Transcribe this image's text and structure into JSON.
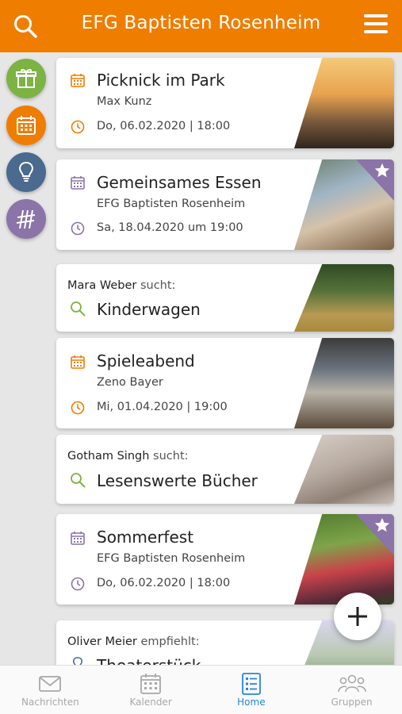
{
  "header": {
    "title": "EFG Baptisten Rosenheim",
    "search_icon": "search-icon",
    "menu_icon": "menu-icon"
  },
  "colors": {
    "brand": "#ef7d00",
    "green": "#7cb342",
    "purple": "#8a74a8",
    "slate": "#4b6a8f",
    "active_tab": "#2a86d6"
  },
  "side_nav": [
    {
      "icon": "gift-icon"
    },
    {
      "icon": "calendar-icon"
    },
    {
      "icon": "lightbulb-icon"
    },
    {
      "icon": "tags-icon"
    }
  ],
  "feed": [
    {
      "kind": "event",
      "title": "Picknick im Park",
      "organizer": "Max Kunz",
      "datetime": "Do, 06.02.2020 | 18:00",
      "accent": "orange",
      "starred": false
    },
    {
      "kind": "event",
      "title": "Gemeinsames Essen",
      "organizer": "EFG Baptisten Rosenheim",
      "datetime": "Sa, 18.04.2020 um 19:00",
      "accent": "purple",
      "starred": true
    },
    {
      "kind": "search",
      "person": "Mara Weber",
      "verb": "sucht:",
      "title": "Kinderwagen"
    },
    {
      "kind": "event",
      "title": "Spieleabend",
      "organizer": "Zeno Bayer",
      "datetime": "Mi, 01.04.2020 | 19:00",
      "accent": "orange",
      "starred": false
    },
    {
      "kind": "search",
      "person": "Gotham Singh",
      "verb": "sucht:",
      "title": "Lesenswerte Bücher"
    },
    {
      "kind": "event",
      "title": "Sommerfest",
      "organizer": "EFG Baptisten Rosenheim",
      "datetime": "Do, 06.02.2020 | 18:00",
      "accent": "purple",
      "starred": true
    },
    {
      "kind": "recommend",
      "person": "Oliver Meier",
      "verb": "empfiehlt:",
      "title": "Theaterstück"
    }
  ],
  "fab": {
    "icon": "plus-icon"
  },
  "tabs": [
    {
      "label": "Nachrichten",
      "icon": "envelope-icon",
      "active": false
    },
    {
      "label": "Kalender",
      "icon": "calendar-icon",
      "active": false
    },
    {
      "label": "Home",
      "icon": "list-icon",
      "active": true
    },
    {
      "label": "Gruppen",
      "icon": "group-icon",
      "active": false
    }
  ]
}
